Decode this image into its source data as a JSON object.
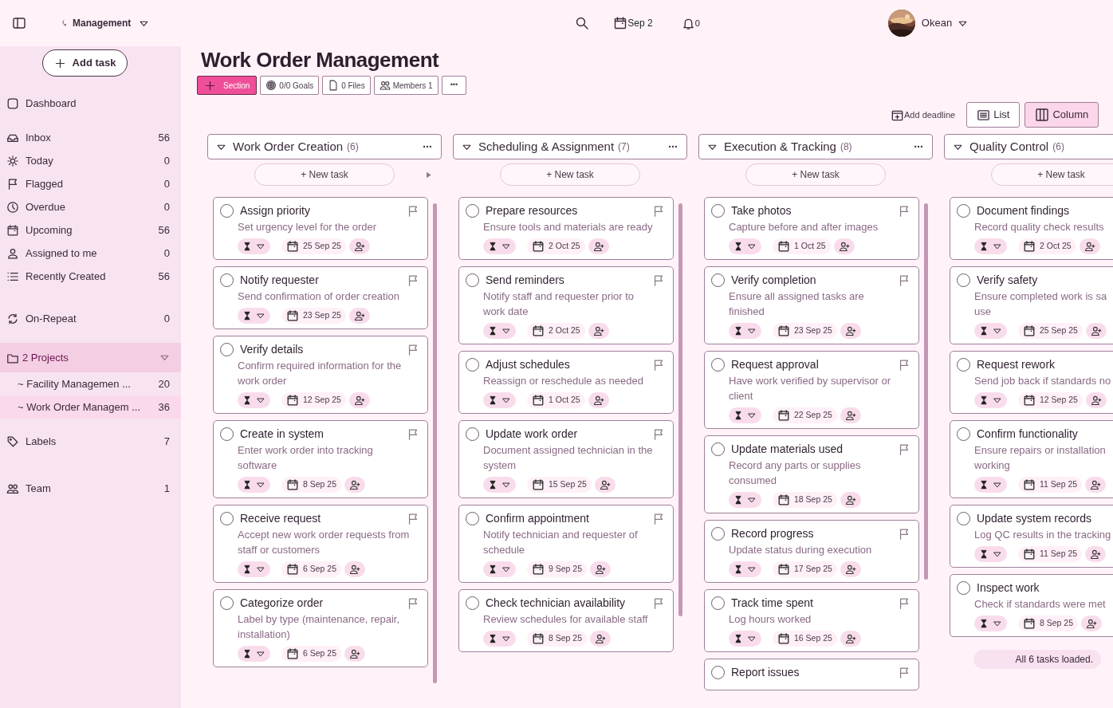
{
  "topbar": {
    "workspace": "Management",
    "date": "Sep 2",
    "notifications": "0",
    "user": "Okean"
  },
  "sidebar": {
    "add_task": "Add task",
    "nav": [
      {
        "label": "Dashboard"
      },
      {
        "label": "Inbox",
        "count": "56"
      },
      {
        "label": "Today",
        "count": "0"
      },
      {
        "label": "Flagged",
        "count": "0"
      },
      {
        "label": "Overdue",
        "count": "0"
      },
      {
        "label": "Upcoming",
        "count": "56"
      },
      {
        "label": "Assigned to me",
        "count": "0"
      },
      {
        "label": "Recently Created",
        "count": "56"
      }
    ],
    "on_repeat": {
      "label": "On-Repeat",
      "count": "0"
    },
    "projects": {
      "label": "2 Projects",
      "expanded": true,
      "items": [
        {
          "label": "~ Facility Managemen ...",
          "count": "20",
          "selected": false
        },
        {
          "label": "~ Work Order Managem ...",
          "count": "36",
          "selected": true
        }
      ]
    },
    "labels": {
      "label": "Labels",
      "count": "7"
    },
    "team": {
      "label": "Team",
      "count": "1"
    }
  },
  "project": {
    "title": "Work Order Management",
    "toolbar": [
      {
        "kind": "section",
        "label": "Section"
      },
      {
        "kind": "goals",
        "label": "0/0 Goals"
      },
      {
        "kind": "files",
        "label": "0 Files"
      },
      {
        "kind": "members",
        "label": "Members 1"
      },
      {
        "kind": "more",
        "label": "•••"
      }
    ],
    "add_deadline": "Add deadline",
    "views": [
      {
        "kind": "list",
        "label": "List",
        "selected": false
      },
      {
        "kind": "column",
        "label": "Column",
        "selected": true
      }
    ]
  },
  "columns": [
    {
      "title": "Work Order Creation",
      "count": "(6)",
      "new_task": "+ New task",
      "collapse_arrow": true,
      "scroll": true,
      "tasks": [
        {
          "title": "Assign priority",
          "description": "Set urgency level for the order",
          "date": "25 Sep 25",
          "checked": false
        },
        {
          "title": "Notify requester",
          "description": "Send confirmation of order creation",
          "date": "23 Sep 25",
          "checked": false
        },
        {
          "title": "Verify details",
          "description": "Confirm required information for the work order",
          "date": "12 Sep 25",
          "checked": false
        },
        {
          "title": "Create in system",
          "description": "Enter work order into tracking software",
          "date": "8 Sep 25",
          "checked": false
        },
        {
          "title": "Receive request",
          "description": "Accept new work order requests from staff or customers",
          "date": "6 Sep 25",
          "checked": false
        },
        {
          "title": "Categorize order",
          "description": "Label by type (maintenance, repair, installation)",
          "date": "6 Sep 25",
          "checked": false
        }
      ]
    },
    {
      "title": "Scheduling & Assignment",
      "count": "(7)",
      "new_task": "+ New task",
      "collapse_arrow": false,
      "scroll": true,
      "tasks": [
        {
          "title": "Prepare resources",
          "description": "Ensure tools and materials are ready",
          "date": "2 Oct 25",
          "checked": false
        },
        {
          "title": "Send reminders",
          "description": "Notify staff and requester prior to work date",
          "date": "2 Oct 25",
          "checked": false
        },
        {
          "title": "Adjust schedules",
          "description": "Reassign or reschedule as needed",
          "date": "1 Oct 25",
          "checked": false
        },
        {
          "title": "Update work order",
          "description": "Document assigned technician in the system",
          "date": "15 Sep 25",
          "checked": false
        },
        {
          "title": "Confirm appointment",
          "description": "Notify technician and requester of schedule",
          "date": "9 Sep 25",
          "checked": false
        },
        {
          "title": "Check technician availability",
          "description": "Review schedules for available staff",
          "date": "8 Sep 25",
          "checked": false
        }
      ]
    },
    {
      "title": "Execution & Tracking",
      "count": "(8)",
      "new_task": "+ New task",
      "collapse_arrow": false,
      "scroll": true,
      "tasks": [
        {
          "title": "Take photos",
          "description": "Capture before and after images",
          "date": "1 Oct 25",
          "checked": false
        },
        {
          "title": "Verify completion",
          "description": "Ensure all assigned tasks are finished",
          "date": "23 Sep 25",
          "checked": false
        },
        {
          "title": "Request approval",
          "description": "Have work verified by supervisor or client",
          "date": "22 Sep 25",
          "checked": false
        },
        {
          "title": "Update materials used",
          "description": "Record any parts or supplies consumed",
          "date": "18 Sep 25",
          "checked": false
        },
        {
          "title": "Record progress",
          "description": "Update status during execution",
          "date": "17 Sep 25",
          "checked": false
        },
        {
          "title": "Track time spent",
          "description": "Log hours worked",
          "date": "16 Sep 25",
          "checked": false
        },
        {
          "title": "Report issues",
          "checked": false
        }
      ]
    },
    {
      "title": "Quality Control",
      "count": "(6)",
      "new_task": "+ New task",
      "collapse_arrow": false,
      "scroll": false,
      "footer": "All 6 tasks loaded.",
      "tasks": [
        {
          "title": "Document findings",
          "description": "Record quality check results",
          "date": "2 Oct 25",
          "checked": false
        },
        {
          "title": "Verify safety",
          "description": [
            "Ensure completed work is sa",
            "use"
          ],
          "date": "25 Sep 25",
          "checked": false
        },
        {
          "title": "Request rework",
          "description": "Send job back if standards no",
          "date": "12 Sep 25",
          "checked": false
        },
        {
          "title": "Confirm functionality",
          "description": [
            "Ensure repairs or installation",
            "working"
          ],
          "date": "11 Sep 25",
          "checked": false
        },
        {
          "title": "Update system records",
          "description": "Log QC results in the tracking",
          "date": "11 Sep 25",
          "checked": false
        },
        {
          "title": "Inspect work",
          "description": "Check if standards were met",
          "date": "8 Sep 25",
          "checked": false
        }
      ]
    }
  ]
}
